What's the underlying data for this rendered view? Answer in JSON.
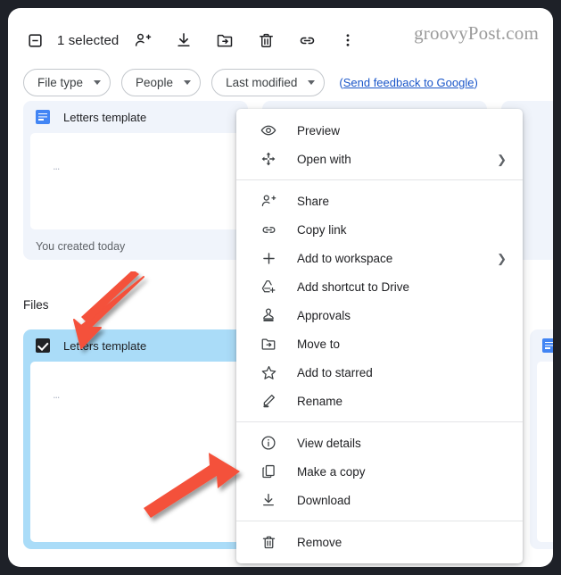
{
  "toolbar": {
    "deselect_icon": "deselect-icon",
    "selected_label": "1 selected",
    "actions": [
      {
        "name": "share-icon",
        "title": "Share"
      },
      {
        "name": "download-icon",
        "title": "Download"
      },
      {
        "name": "move-icon",
        "title": "Move to"
      },
      {
        "name": "trash-icon",
        "title": "Remove"
      },
      {
        "name": "link-icon",
        "title": "Copy link"
      },
      {
        "name": "more-icon",
        "title": "More actions"
      }
    ],
    "watermark": "groovyPost.com"
  },
  "filters": {
    "chips": [
      {
        "label": "File type"
      },
      {
        "label": "People"
      },
      {
        "label": "Last modified"
      }
    ],
    "feedback_open": "(",
    "feedback_link": "Send feedback to Google",
    "feedback_close": ")"
  },
  "suggested": {
    "card": {
      "title": "Letters template",
      "icon": "google-docs-icon",
      "thumb_text": "•••",
      "footer": "You created today"
    }
  },
  "files": {
    "section_label": "Files",
    "cards": [
      {
        "title": "Letters template",
        "selected": true,
        "checkbox_checked": true,
        "thumb_text": "•••"
      },
      {
        "title": "",
        "selected": false,
        "icon": "google-docs-icon",
        "thumb_text": "•••"
      }
    ]
  },
  "context_menu": {
    "groups": [
      {
        "items": [
          {
            "icon": "eye-icon",
            "label": "Preview",
            "submenu": false
          },
          {
            "icon": "open-with-icon",
            "label": "Open with",
            "submenu": true
          }
        ]
      },
      {
        "items": [
          {
            "icon": "person-add-icon",
            "label": "Share",
            "submenu": false
          },
          {
            "icon": "link-icon",
            "label": "Copy link",
            "submenu": false
          },
          {
            "icon": "plus-icon",
            "label": "Add to workspace",
            "submenu": true
          },
          {
            "icon": "drive-shortcut-icon",
            "label": "Add shortcut to Drive",
            "submenu": false
          },
          {
            "icon": "approvals-icon",
            "label": "Approvals",
            "submenu": false
          },
          {
            "icon": "move-folder-icon",
            "label": "Move to",
            "submenu": false
          },
          {
            "icon": "star-icon",
            "label": "Add to starred",
            "submenu": false
          },
          {
            "icon": "pencil-icon",
            "label": "Rename",
            "submenu": false
          }
        ]
      },
      {
        "items": [
          {
            "icon": "info-icon",
            "label": "View details",
            "submenu": false
          },
          {
            "icon": "copy-icon",
            "label": "Make a copy",
            "submenu": false
          },
          {
            "icon": "download-icon",
            "label": "Download",
            "submenu": false
          }
        ]
      },
      {
        "items": [
          {
            "icon": "trash-icon",
            "label": "Remove",
            "submenu": false
          }
        ]
      }
    ]
  },
  "annotations": {
    "arrow_color": "#f4513b",
    "arrows": [
      {
        "name": "arrow-to-checkbox",
        "target": "file-checkbox"
      },
      {
        "name": "arrow-to-make-a-copy",
        "target": "make-a-copy"
      }
    ]
  },
  "colors": {
    "accent_blue": "#4285f4",
    "selected_card": "#aadcf8",
    "suggested_card": "#f0f4fb",
    "link": "#1a56c9",
    "arrow_red": "#f4513b"
  }
}
